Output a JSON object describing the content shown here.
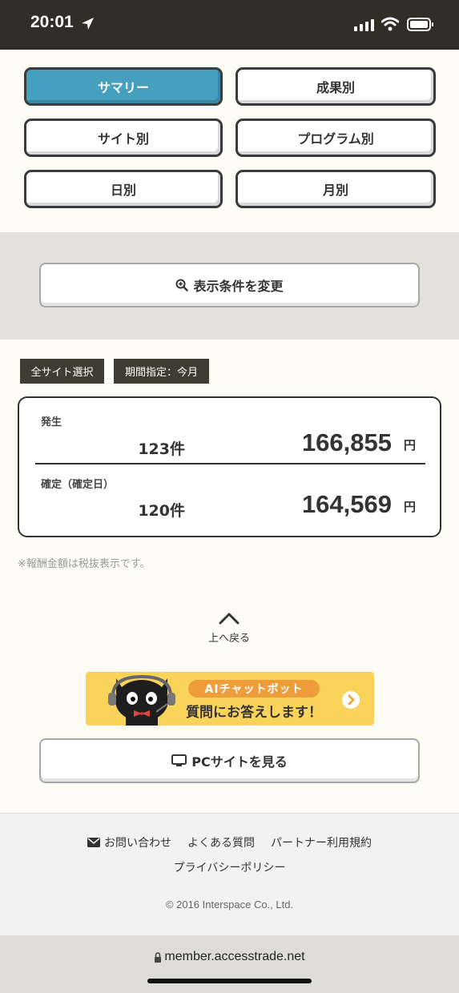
{
  "status_bar": {
    "time": "20:01"
  },
  "tabs": [
    {
      "label": "サマリー",
      "active": true
    },
    {
      "label": "成果別",
      "active": false
    },
    {
      "label": "サイト別",
      "active": false
    },
    {
      "label": "プログラム別",
      "active": false
    },
    {
      "label": "日別",
      "active": false
    },
    {
      "label": "月別",
      "active": false
    }
  ],
  "filter": {
    "change_button_label": "表示条件を変更",
    "icon": "zoom-in-icon"
  },
  "tags": {
    "site": "全サイト選択",
    "period": "期間指定：今月"
  },
  "summary": {
    "rows": [
      {
        "label": "発生",
        "count": "123件",
        "amount": "166,855",
        "unit": "円"
      },
      {
        "label": "確定（確定日）",
        "count": "120件",
        "amount": "164,569",
        "unit": "円"
      }
    ]
  },
  "note": "※報酬金額は税抜表示です。",
  "back_to_top": {
    "label": "上へ戻る",
    "icon": "chevron-up-icon"
  },
  "banner": {
    "pill": "AIチャットボット",
    "sub": "質問にお答えします！",
    "colors": {
      "bg": "#f9d35a",
      "pill": "#ee9d3a"
    }
  },
  "pc_site": {
    "label": "PCサイトを見る",
    "icon": "monitor-icon"
  },
  "footer": {
    "links": [
      "お問い合わせ",
      "よくある質問",
      "パートナー利用規約"
    ],
    "privacy": "プライバシーポリシー",
    "copyright": "© 2016 Interspace Co., Ltd."
  },
  "url_bar": {
    "url": "member.accesstrade.net"
  },
  "colors": {
    "accent": "#45a0bf",
    "header_bg": "#302e26",
    "tag_bg": "#3f3c33"
  }
}
